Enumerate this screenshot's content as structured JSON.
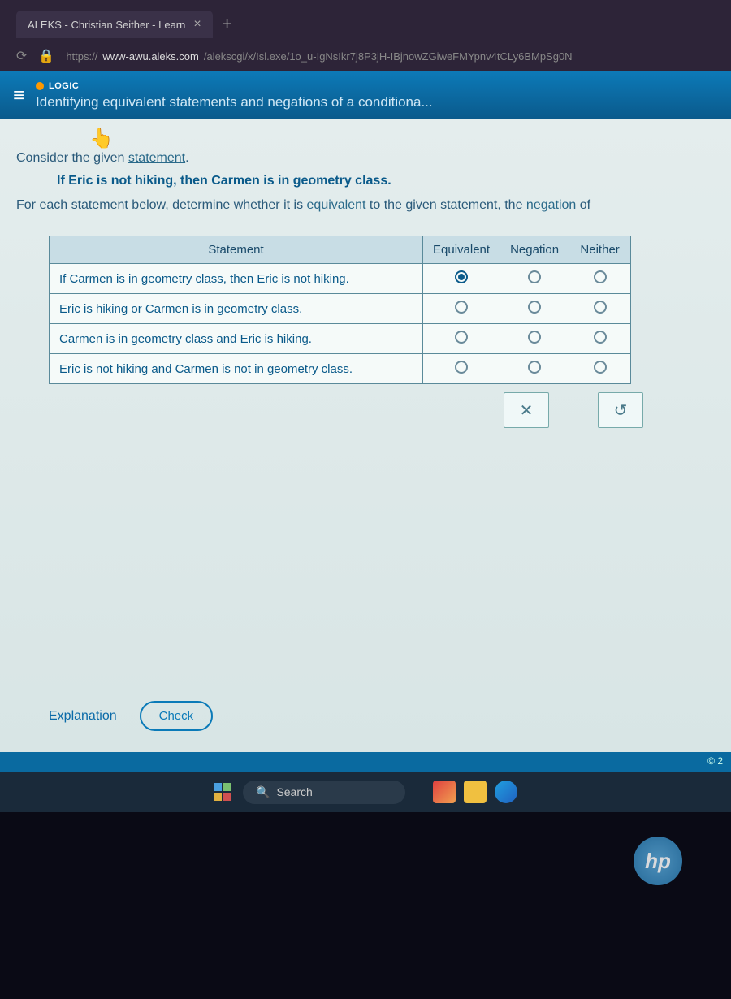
{
  "browser": {
    "tab_title": "ALEKS - Christian Seither - Learn",
    "url_prefix": "https://",
    "url_domain": "www-awu.aleks.com",
    "url_path": "/alekscgi/x/Isl.exe/1o_u-IgNsIkr7j8P3jH-IBjnowZGiweFMYpnv4tCLy6BMpSg0N"
  },
  "header": {
    "tag": "LOGIC",
    "title": "Identifying equivalent statements and negations of a conditiona..."
  },
  "prompt": {
    "intro_before": "Consider the given ",
    "intro_link": "statement",
    "intro_after": ".",
    "given": "If Eric is not hiking, then Carmen is in geometry class.",
    "instr_before": "For each statement below, determine whether it is ",
    "equiv_word": "equivalent",
    "instr_mid": " to the given statement, the ",
    "neg_word": "negation",
    "instr_after": " of "
  },
  "table": {
    "head_stmt": "Statement",
    "head_eq": "Equivalent",
    "head_neg": "Negation",
    "head_nei": "Neither",
    "rows": [
      {
        "text": "If Carmen is in geometry class, then Eric is not hiking.",
        "selected": "eq"
      },
      {
        "text": "Eric is hiking or Carmen is in geometry class.",
        "selected": ""
      },
      {
        "text": "Carmen is in geometry class and Eric is hiking.",
        "selected": ""
      },
      {
        "text": "Eric is not hiking and Carmen is not in geometry class.",
        "selected": ""
      }
    ]
  },
  "tools": {
    "clear": "✕",
    "reset": "↺"
  },
  "actions": {
    "explanation": "Explanation",
    "check": "Check"
  },
  "footer": {
    "copyright": "© 2"
  },
  "taskbar": {
    "search": "Search"
  },
  "hp": "hp"
}
